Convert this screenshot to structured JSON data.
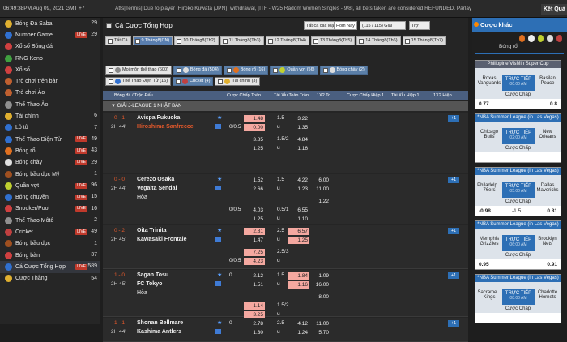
{
  "topbar": {
    "clock": "06:49:38PM Aug 09, 2021 GMT +7",
    "ticker": "Atts[Tennis] Due to player [Hiroko Kuwata (JPN)] withdrawal, [ITF - W25 Radom Women Singles - 9/8], all bets taken are considered REFUNDED. Parlay counted",
    "result_button": "Kết Quả"
  },
  "sidebar": {
    "items": [
      {
        "label": "Bóng Đá Saba",
        "count": "29",
        "live": false,
        "color": "#e0b030"
      },
      {
        "label": "Number Game",
        "count": "29",
        "live": true,
        "color": "#3070d0"
      },
      {
        "label": "Xổ số Bóng đá",
        "count": "",
        "live": false,
        "color": "#d04040"
      },
      {
        "label": "RNG Keno",
        "count": "",
        "live": false,
        "color": "#40a040"
      },
      {
        "label": "Xổ số",
        "count": "",
        "live": false,
        "color": "#d04040"
      },
      {
        "label": "Trò chơi trên bàn",
        "count": "",
        "live": false,
        "color": "#c06030"
      },
      {
        "label": "Trò chơi Ảo",
        "count": "",
        "live": false,
        "color": "#c06030"
      },
      {
        "label": "Thể Thao Ảo",
        "count": "",
        "live": false,
        "color": "#909090"
      },
      {
        "label": "Tài chính",
        "count": "6",
        "live": false,
        "color": "#e0b030"
      },
      {
        "label": "Lô tô",
        "count": "7",
        "live": false,
        "color": "#3070d0"
      },
      {
        "label": "Thể Thao Điện Tử",
        "count": "49",
        "live": true,
        "color": "#3070d0"
      },
      {
        "label": "Bóng rổ",
        "count": "43",
        "live": true,
        "color": "#e07020"
      },
      {
        "label": "Bóng chày",
        "count": "29",
        "live": true,
        "color": "#e0e0e0"
      },
      {
        "label": "Bóng bầu dục Mỹ",
        "count": "1",
        "live": false,
        "color": "#a05020"
      },
      {
        "label": "Quần vợt",
        "count": "96",
        "live": true,
        "color": "#c0d030"
      },
      {
        "label": "Bóng chuyền",
        "count": "15",
        "live": true,
        "color": "#3070d0"
      },
      {
        "label": "Snooker/Pool",
        "count": "16",
        "live": true,
        "color": "#d04040"
      },
      {
        "label": "Thể Thao Môtô",
        "count": "2",
        "live": false,
        "color": "#909090"
      },
      {
        "label": "Cricket",
        "count": "49",
        "live": true,
        "color": "#c04040"
      },
      {
        "label": "Bóng bầu dục",
        "count": "1",
        "live": false,
        "color": "#a05020"
      },
      {
        "label": "Bóng bàn",
        "count": "37",
        "live": false,
        "color": "#d04040"
      },
      {
        "label": "Cá Cược Tổng Hợp",
        "count": "589",
        "live": true,
        "color": "#3070d0"
      },
      {
        "label": "Cược Thắng",
        "count": "54",
        "live": false,
        "color": "#e0b030"
      }
    ],
    "live_label": "LIVE"
  },
  "main": {
    "title": "Cá Cược Tổng Hợp",
    "dropdown_types": "Tất cả các loại cược",
    "today_button": "Hôm Nay",
    "league_select": "(115 / 115) Giải",
    "help_select": "Trợ giúp",
    "date_tabs": [
      "Tất Cả",
      "9 Tháng8(CN)",
      "10 Tháng8(Th2)",
      "11 Tháng8(Th3)",
      "12 Tháng8(Th4)",
      "13 Tháng8(Th5)",
      "14 Tháng8(Th6)",
      "15 Tháng8(Th7)"
    ],
    "sports_row1": [
      "Mọi môn thể thao (600)",
      "Bóng đá (504)",
      "Bóng rổ (16)",
      "Quần vợt (56)",
      "Bóng chày (2)"
    ],
    "sports_row2": [
      "Thể Thao Điện Tử (16)",
      "Cricket (4)",
      "Tài chính (3)"
    ],
    "columns": [
      "Bóng đá / Trận Đấu",
      "Cược Chấp Toàn...",
      "Tài Xỉu Toàn Trận",
      "1X2 To...",
      "Cược Chấp Hiệp 1",
      "Tài Xỉu Hiệp 1",
      "1X2 Hiệp..."
    ],
    "league": "GIẢI J-LEAGUE 1 NHẬT BẢN",
    "plus_label": "+1",
    "under_label": "u",
    "matches": [
      {
        "score": "0 - 1",
        "time": "2H 44'",
        "home": "Avispa Fukuoka",
        "away": "Hiroshima Sanfrecce",
        "draw": "",
        "lines": [
          {
            "hc": "",
            "o1": "1.48",
            "tx": "1.5",
            "o2": "3.22",
            "x": ""
          },
          {
            "hc": "0/0.5",
            "o1": "0.00",
            "tx": "u",
            "o2": "1.35",
            "x": ""
          },
          {
            "hc": "",
            "o1": "3.85",
            "tx": "1.5/2",
            "o2": "4.84",
            "x": ""
          },
          {
            "hc": "",
            "o1": "1.25",
            "tx": "u",
            "o2": "1.16",
            "x": ""
          }
        ]
      },
      {
        "score": "0 - 0",
        "time": "2H 44'",
        "home": "Cerezo Osaka",
        "away": "Vegalta Sendai",
        "draw": "Hòa",
        "lines": [
          {
            "hc": "",
            "o1": "1.52",
            "tx": "1.5",
            "o2": "4.22",
            "x": "6.00"
          },
          {
            "hc": "",
            "o1": "2.66",
            "tx": "u",
            "o2": "1.23",
            "x": "11.00"
          },
          {
            "hc": "",
            "o1": "",
            "tx": "",
            "o2": "",
            "x": "1.22"
          },
          {
            "hc": "0/0.5",
            "o1": "4.03",
            "tx": "0.5/1",
            "o2": "6.55",
            "x": ""
          },
          {
            "hc": "",
            "o1": "1.25",
            "tx": "u",
            "o2": "1.10",
            "x": ""
          }
        ]
      },
      {
        "score": "0 - 2",
        "time": "2H 45'",
        "home": "Oita Trinita",
        "away": "Kawasaki Frontale",
        "draw": "",
        "lines": [
          {
            "hc": "",
            "o1": "2.81",
            "tx": "2.5",
            "o2": "6.57",
            "x": ""
          },
          {
            "hc": "",
            "o1": "1.47",
            "tx": "u",
            "o2": "1.25",
            "x": ""
          },
          {
            "hc": "",
            "o1": "7.25",
            "tx": "2.5/3",
            "o2": "",
            "x": ""
          },
          {
            "hc": "0/0.5",
            "o1": "4.23",
            "tx": "u",
            "o2": "",
            "x": ""
          }
        ]
      },
      {
        "score": "1 - 0",
        "time": "2H 45'",
        "home": "Sagan Tosu",
        "away": "FC Tokyo",
        "draw": "Hòa",
        "lines": [
          {
            "hc": "0",
            "o1": "2.12",
            "tx": "1.5",
            "o2": "1.84",
            "x": "1.09"
          },
          {
            "hc": "",
            "o1": "1.51",
            "tx": "u",
            "o2": "1.16",
            "x": "16.00"
          },
          {
            "hc": "",
            "o1": "",
            "tx": "",
            "o2": "",
            "x": "8.00"
          },
          {
            "hc": "",
            "o1": "1.14",
            "tx": "1.5/2",
            "o2": "",
            "x": ""
          },
          {
            "hc": "",
            "o1": "3.25",
            "tx": "u",
            "o2": "",
            "x": ""
          }
        ]
      },
      {
        "score": "1 - 1",
        "time": "2H 44'",
        "home": "Shonan Bellmare",
        "away": "Kashima Antlers",
        "draw": "",
        "lines": [
          {
            "hc": "0",
            "o1": "2.78",
            "tx": "2.5",
            "o2": "4.12",
            "x": "11.00"
          },
          {
            "hc": "",
            "o1": "1.30",
            "tx": "u",
            "o2": "1.24",
            "x": "5.70"
          }
        ]
      }
    ]
  },
  "right_panel": {
    "title": "Cược khác",
    "tab": "Bóng rổ",
    "handicap_label": "Cược Chấp",
    "live_label": "TRỰC TIẾP",
    "cards": [
      {
        "title": "Philippine VisMin Super Cup",
        "home": "Roxas Vanguards",
        "away": "Basilan Peace",
        "time": "00:00 AM",
        "left": "0.77",
        "mid": "",
        "right": "0.8"
      },
      {
        "title": "*NBA Summer League (in Las Vegas)",
        "home": "Chicago Bulls",
        "away": "New Orleans",
        "time": "02:00 AM",
        "left": "",
        "mid": "",
        "right": ""
      },
      {
        "title": "*NBA Summer League (in Las Vegas)",
        "home": "Philadelp... 76ers",
        "away": "Dallas Mavericks",
        "time": "05:00 AM",
        "left": "-0.98",
        "mid": "-1.5",
        "right": "0.81"
      },
      {
        "title": "*NBA Summer League (in Las Vegas)",
        "home": "Memphis Grizzlies",
        "away": "Brooklyn Nets",
        "time": "06:00 AM",
        "left": "0.95",
        "mid": "",
        "right": "0.91"
      },
      {
        "title": "*NBA Summer League (in Las Vegas)",
        "home": "Sacrame... Kings",
        "away": "Charlotte Hornets",
        "time": "08:00 AM",
        "left": "",
        "mid": "",
        "right": ""
      }
    ]
  }
}
